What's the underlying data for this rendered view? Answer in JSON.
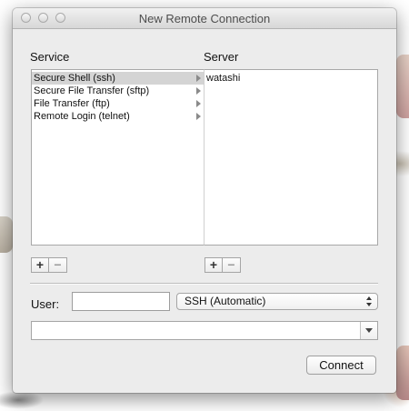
{
  "window": {
    "title": "New Remote Connection"
  },
  "service": {
    "label": "Service",
    "items": [
      {
        "label": "Secure Shell (ssh)",
        "selected": true
      },
      {
        "label": "Secure File Transfer (sftp)",
        "selected": false
      },
      {
        "label": "File Transfer (ftp)",
        "selected": false
      },
      {
        "label": "Remote Login (telnet)",
        "selected": false
      }
    ],
    "add_label": "+",
    "remove_label": "−"
  },
  "server": {
    "label": "Server",
    "items": [
      {
        "label": "watashi"
      }
    ],
    "add_label": "+",
    "remove_label": "−"
  },
  "user": {
    "label": "User:",
    "value": ""
  },
  "protocol": {
    "selected": "SSH (Automatic)",
    "icon": "updown-arrows-icon"
  },
  "command": {
    "value": "",
    "icon": "chevron-down-icon"
  },
  "connect": {
    "label": "Connect"
  },
  "colors": {
    "window_bg": "#ececec",
    "selection_bg": "#d4d4d4",
    "list_bg": "#ffffff"
  }
}
